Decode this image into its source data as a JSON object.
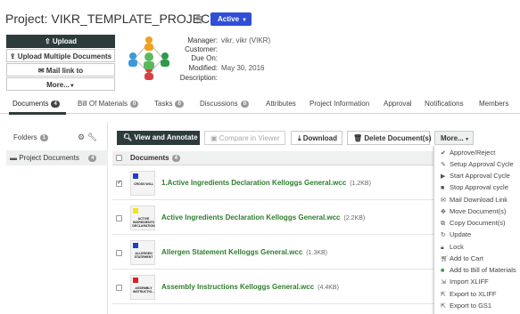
{
  "header": {
    "title": "Project: VIKR_TEMPLATE_PROJECT",
    "status": "Active"
  },
  "actions": {
    "upload": "Upload",
    "upload_multiple": "Upload Multiple Documents",
    "mail_link": "Mail link to",
    "more": "More..."
  },
  "meta": {
    "manager_label": "Manager:",
    "manager_value": "vikr, vikr (VIKR)",
    "customer_label": "Customer:",
    "due_label": "Due On:",
    "modified_label": "Modified:",
    "modified_value": "May 30, 2016",
    "description_label": "Description:"
  },
  "tabs": [
    {
      "label": "Documents",
      "count": "4"
    },
    {
      "label": "Bill Of Materials",
      "count": "0"
    },
    {
      "label": "Tasks",
      "count": "0"
    },
    {
      "label": "Discussions",
      "count": "0"
    },
    {
      "label": "Attributes"
    },
    {
      "label": "Project Information"
    },
    {
      "label": "Approval"
    },
    {
      "label": "Notifications"
    },
    {
      "label": "Members"
    }
  ],
  "folders": {
    "title": "Folders",
    "count": "1",
    "item_label": "Project Documents",
    "item_count": "4"
  },
  "toolbar": {
    "view_annotate": "View and Annotate",
    "compare": "Compare in Viewer",
    "download": "Download",
    "delete": "Delete Document(s)",
    "more": "More..."
  },
  "docs": {
    "header_label": "Documents",
    "header_count": "4",
    "rows": [
      {
        "name": "1.Active Ingredients Declaration Kelloggs General.wcc",
        "size": "(1.2KB)",
        "checked": true,
        "thumb_text": "CROSS WILL",
        "tag_color": "#1f3fc8"
      },
      {
        "name": "Active Ingredients Declaration Kelloggs General.wcc",
        "size": "(2.2KB)",
        "checked": false,
        "thumb_text": "ACTIVE INGREDIENTS DECLARATION",
        "tag_color": "#f2e21a"
      },
      {
        "name": "Allergen Statement Kelloggs General.wcc",
        "size": "(1.3KB)",
        "checked": false,
        "thumb_text": "ALLERGEN STATEMENT",
        "tag_color": "#1f3fc8"
      },
      {
        "name": "Assembly Instructions Kelloggs General.wcc",
        "size": "(4.4KB)",
        "checked": false,
        "thumb_text": "ASSEMBLY INSTRUCTIO...",
        "tag_color": "#e02020"
      }
    ]
  },
  "menu": [
    {
      "label": "Approve/Reject",
      "icon": "check-icon"
    },
    {
      "label": "Setup Approval Cycle",
      "icon": "wrench-icon"
    },
    {
      "label": "Start Approval Cycle",
      "icon": "play-icon"
    },
    {
      "label": "Stop Approval cycle",
      "icon": "stop-icon"
    },
    {
      "label": "Mail Download Link",
      "icon": "mail-icon"
    },
    {
      "label": "Move Document(s)",
      "icon": "move-icon"
    },
    {
      "label": "Copy Document(s)",
      "icon": "copy-icon"
    },
    {
      "label": "Update",
      "icon": "update-icon"
    },
    {
      "label": "Lock",
      "icon": "lock-icon"
    },
    {
      "label": "Add to Cart",
      "icon": "cart-icon"
    },
    {
      "label": "Add to Bill of Materials",
      "icon": "bom-icon"
    },
    {
      "label": "Import XLIFF",
      "icon": "import-icon"
    },
    {
      "label": "Export to XLIFF",
      "icon": "export-icon"
    },
    {
      "label": "Export to GS1",
      "icon": "export-gs1-icon"
    }
  ],
  "colors": {
    "accent_blue": "#2f4fd8",
    "dark_button": "#2d3b3b",
    "doc_link": "#2e7d2e"
  }
}
